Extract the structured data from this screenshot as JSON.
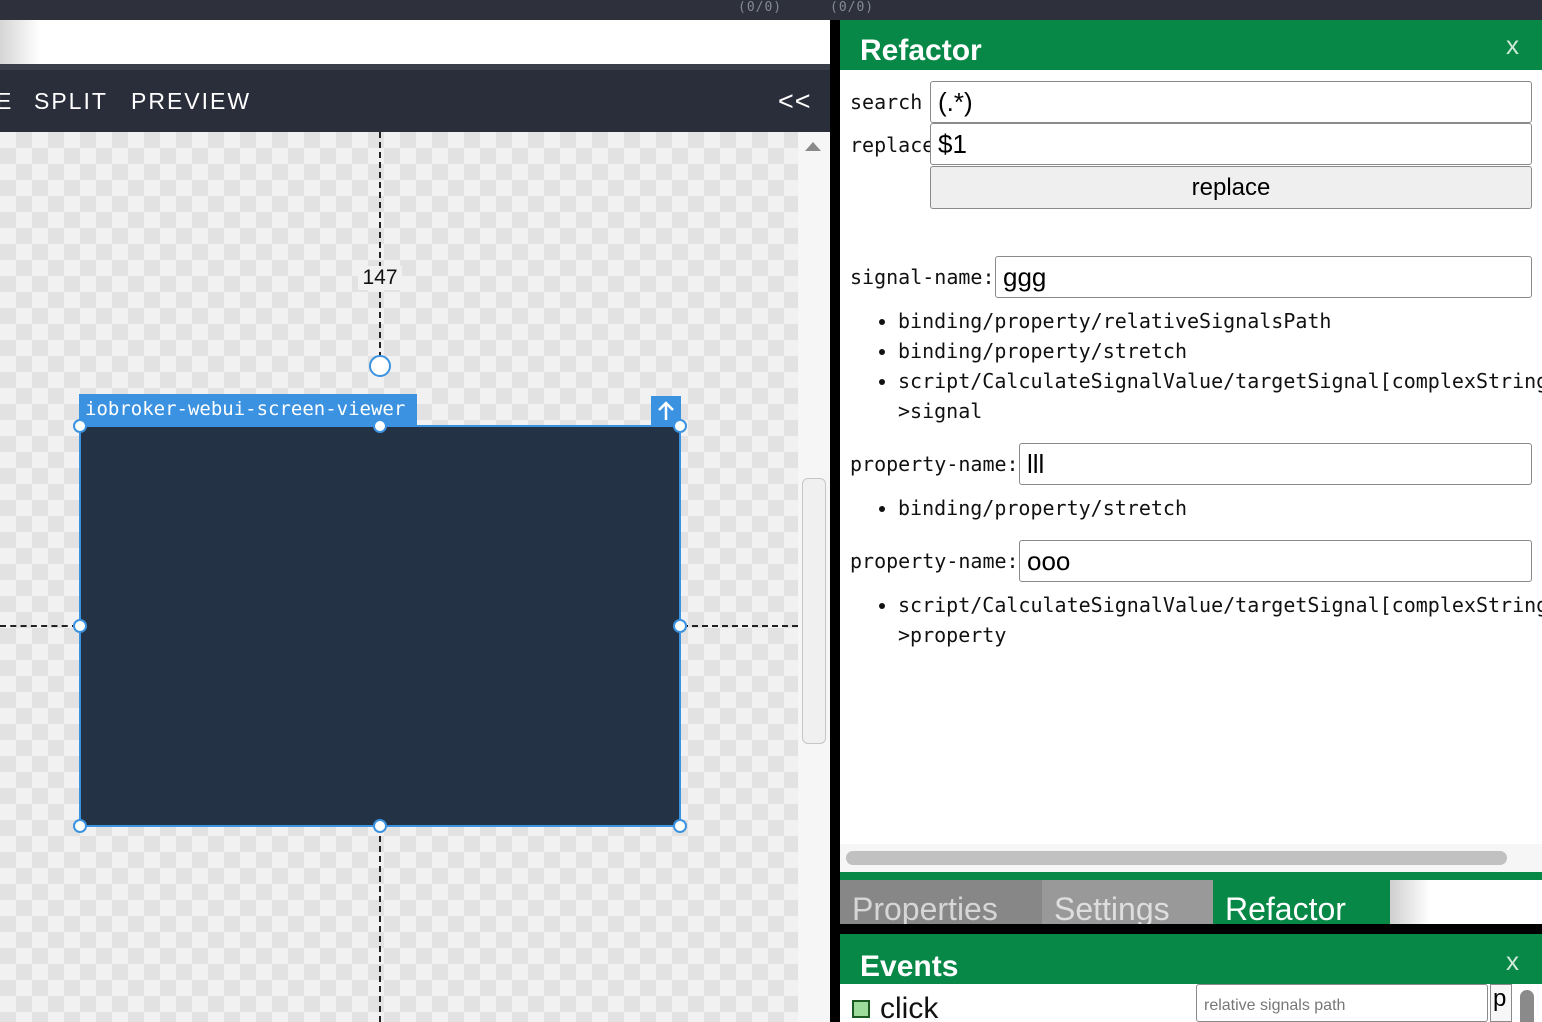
{
  "top_counters": [
    "(0/0)",
    "(0/0)"
  ],
  "designer": {
    "modes": [
      "E",
      "SPLIT",
      "PREVIEW"
    ],
    "collapse_label": "<<",
    "distance_label": "147",
    "element_tag": "iobroker-webui-screen-viewer",
    "element_fill": "#233245",
    "selection_color": "#3b92e0"
  },
  "refactor": {
    "title": "Refactor",
    "close_label": "x",
    "search_label": "search",
    "search_value": "(.*)",
    "replace_label": "replace",
    "replace_value": "$1",
    "replace_button": "replace",
    "groups": [
      {
        "label": "signal-name:",
        "value": "ggg",
        "refs": [
          "binding/property/relativeSignalsPath",
          "binding/property/stretch",
          "script/CalculateSignalValue/targetSignal[complexString]-",
          ">signal"
        ]
      },
      {
        "label": "property-name:",
        "value": "lll",
        "refs": [
          "binding/property/stretch"
        ]
      },
      {
        "label": "property-name:",
        "value": "ooo",
        "refs": [
          "script/CalculateSignalValue/targetSignal[complexString]-",
          ">property"
        ]
      }
    ]
  },
  "tabs": {
    "items": [
      "Properties",
      "Settings",
      "Refactor"
    ],
    "active": "Refactor"
  },
  "events": {
    "title": "Events",
    "close_label": "x",
    "first_event": "click",
    "input_placeholder": "relative signals path",
    "button_label": "p"
  },
  "colors": {
    "panel_green": "#078846",
    "dark_bar": "#2a2d3a"
  }
}
